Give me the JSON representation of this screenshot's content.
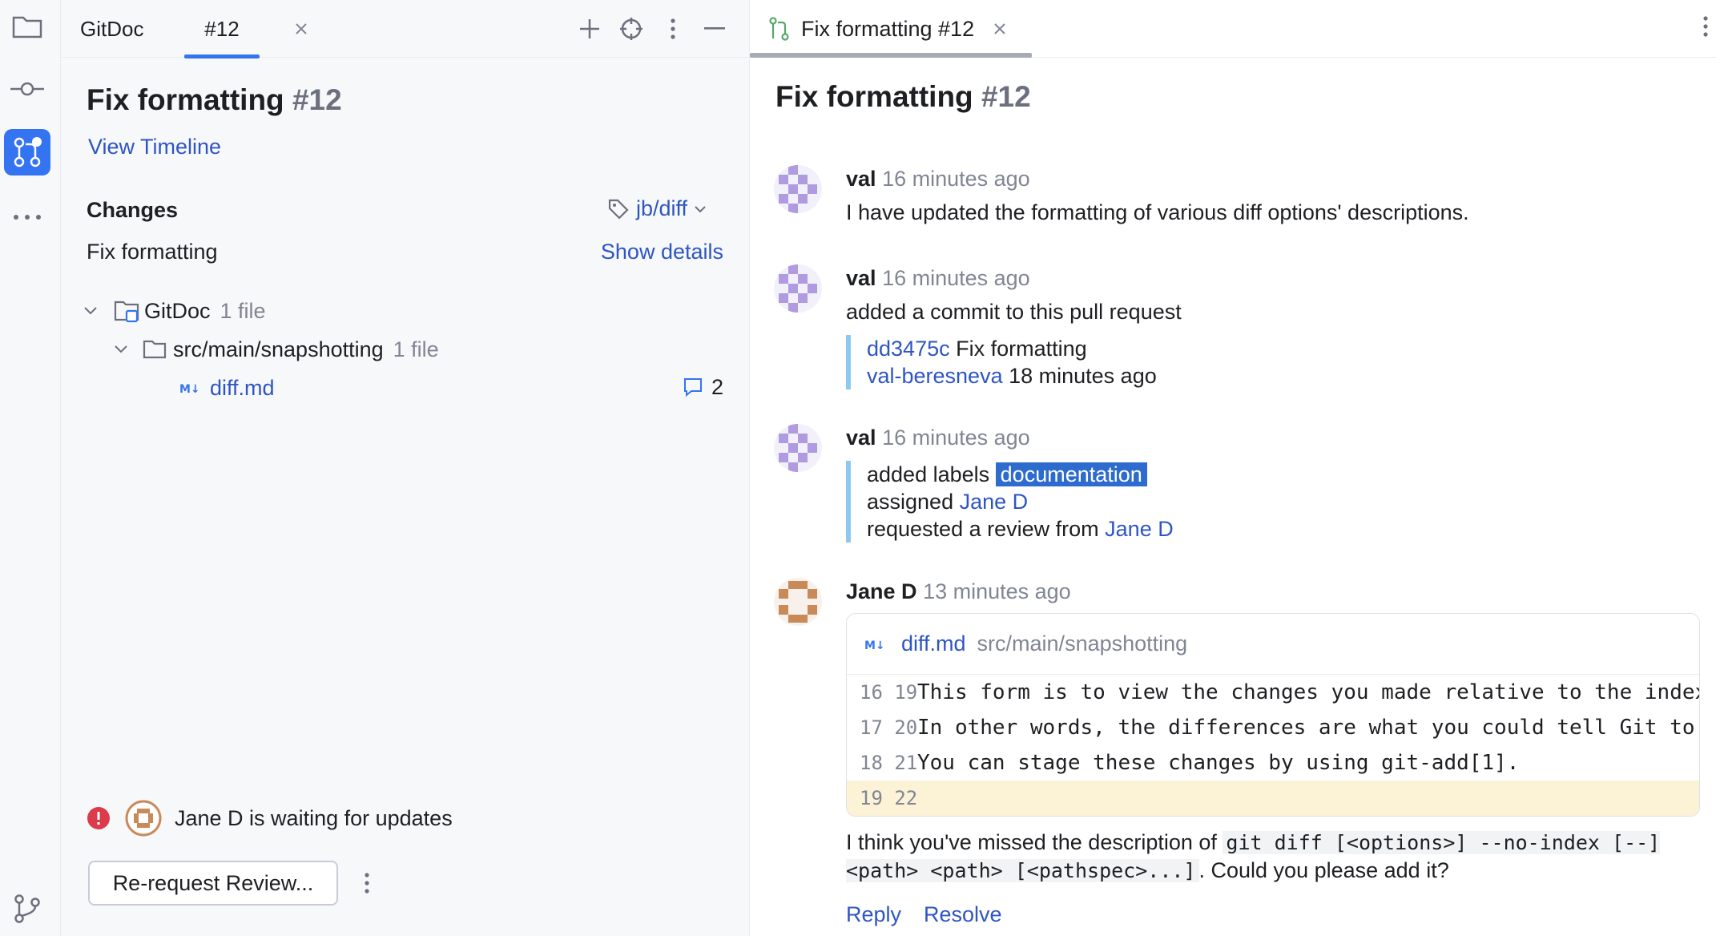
{
  "left_panel": {
    "tabs": [
      {
        "label": "GitDoc"
      },
      {
        "label": "#12"
      }
    ],
    "pr": {
      "title": "Fix formatting",
      "number": "#12"
    },
    "view_timeline": "View Timeline",
    "changes_heading": "Changes",
    "branch": "jb/diff",
    "commit_message": "Fix formatting",
    "show_details": "Show details",
    "tree": {
      "root": {
        "name": "GitDoc",
        "count": "1 file"
      },
      "folder": {
        "name": "src/main/snapshotting",
        "count": "1 file"
      },
      "file": {
        "name": "diff.md",
        "comments": "2"
      }
    },
    "status": "Jane D is waiting for updates",
    "rerequest_button": "Re-request Review..."
  },
  "right_panel": {
    "tab_label": "Fix formatting #12",
    "pr": {
      "title": "Fix formatting",
      "number": "#12"
    },
    "events": [
      {
        "author": "val",
        "time": "16 minutes ago",
        "text": "I have updated the formatting of various diff options' descriptions."
      },
      {
        "author": "val",
        "time": "16 minutes ago",
        "text": "added a commit to this pull request",
        "commit": {
          "hash": "dd3475c",
          "message": "Fix formatting",
          "user": "val-beresneva",
          "time": "18 minutes ago"
        }
      },
      {
        "author": "val",
        "time": "16 minutes ago",
        "added_labels_prefix": "added labels",
        "label": "documentation",
        "assigned_prefix": "assigned",
        "assignee": "Jane D",
        "review_prefix": "requested a review from",
        "reviewer": "Jane D"
      },
      {
        "author": "Jane D",
        "time": "13 minutes ago"
      }
    ],
    "code_card": {
      "file": "diff.md",
      "path": "src/main/snapshotting",
      "lines": [
        {
          "old": "16",
          "new": "19",
          "text": "This form is to view the changes you made relative to the index"
        },
        {
          "old": "17",
          "new": "20",
          "text": "In other words, the differences are what you could tell Git to"
        },
        {
          "old": "18",
          "new": "21",
          "text": "You can stage these changes by using git-add[1]."
        },
        {
          "old": "19",
          "new": "22",
          "text": ""
        }
      ]
    },
    "comment": {
      "pre": "I think you've missed the description of ",
      "code": "git diff [<options>] --no-index [--] <path> <path> [<pathspec>...]",
      "post": ". Could you please add it?"
    },
    "actions": {
      "reply": "Reply",
      "resolve": "Resolve"
    }
  },
  "colors": {
    "accent": "#3574f0",
    "link": "#2e55c4",
    "label": "#2e6bcf",
    "timeline_bar": "#8ec8ee",
    "error": "#db3b4b"
  }
}
